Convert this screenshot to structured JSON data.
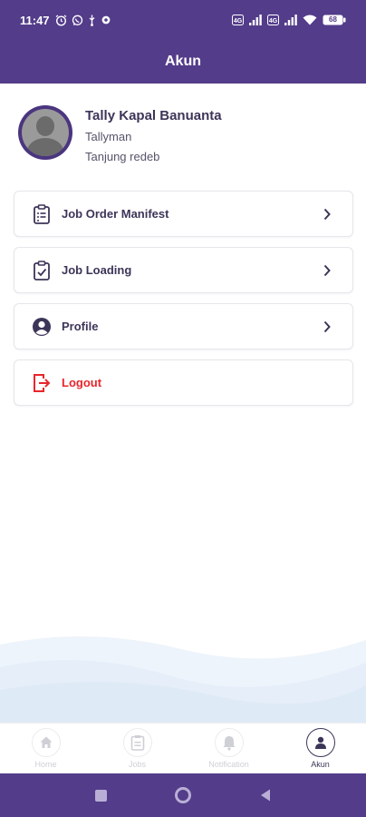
{
  "status_bar": {
    "time": "11:47",
    "icons": [
      "alarm-icon",
      "whatsapp-icon",
      "usb-icon",
      "settings-icon"
    ],
    "right_icons": [
      "volte-icon",
      "signal-icon",
      "volte-icon",
      "signal-icon",
      "wifi-icon",
      "battery-icon"
    ],
    "battery": "68"
  },
  "app_bar": {
    "title": "Akun"
  },
  "profile": {
    "name": "Tally Kapal Banuanta",
    "role": "Tallyman",
    "location": "Tanjung redeb"
  },
  "menu": [
    {
      "label": "Job Order Manifest",
      "icon": "clipboard-list-icon"
    },
    {
      "label": "Job Loading",
      "icon": "clipboard-check-icon"
    },
    {
      "label": "Profile",
      "icon": "user-circle-icon"
    },
    {
      "label": "Logout",
      "icon": "logout-icon"
    }
  ],
  "bottom_nav": [
    {
      "label": "Home",
      "icon": "home-icon",
      "active": false
    },
    {
      "label": "Jobs",
      "icon": "jobs-icon",
      "active": false
    },
    {
      "label": "Notification",
      "icon": "bell-icon",
      "active": false
    },
    {
      "label": "Akun",
      "icon": "person-icon",
      "active": true
    }
  ],
  "colors": {
    "primary": "#533c8a",
    "text_dark": "#3d3558",
    "logout": "#e8262b",
    "inactive": "#d0d0d6"
  }
}
